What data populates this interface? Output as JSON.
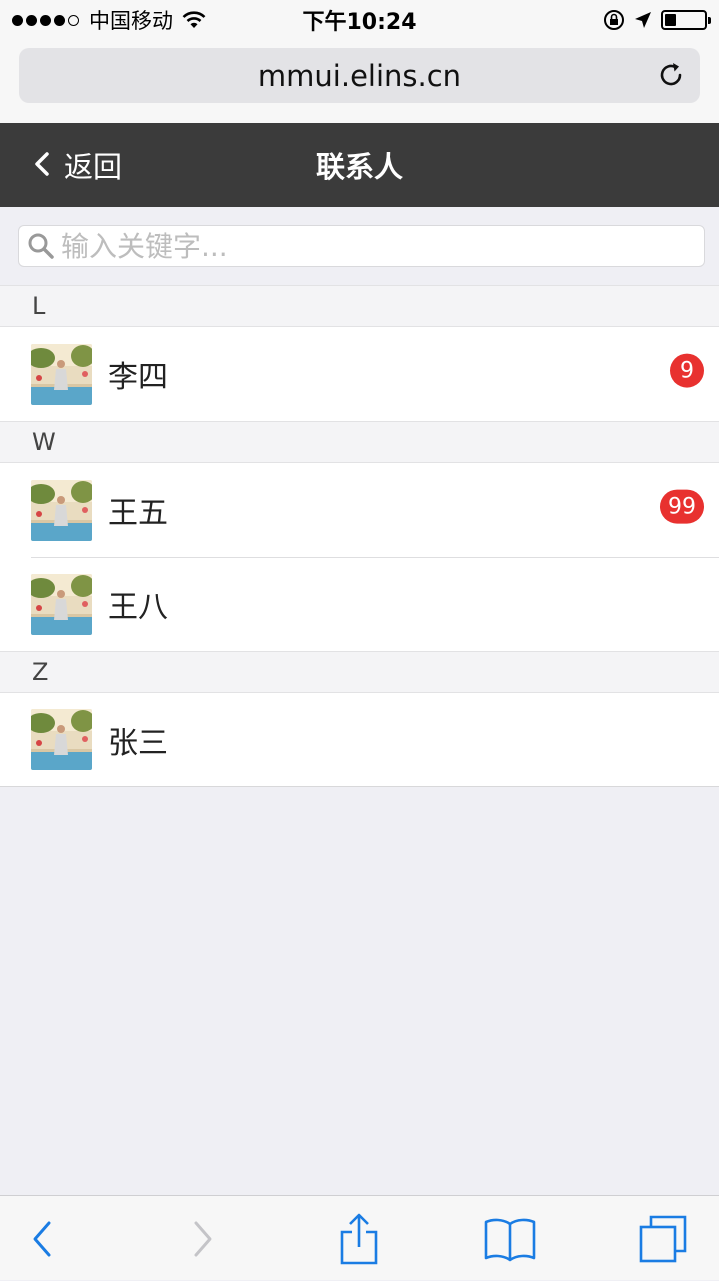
{
  "status_bar": {
    "carrier": "中国移动",
    "time": "下午10:24",
    "battery_level": 0.3
  },
  "browser": {
    "url": "mmui.elins.cn"
  },
  "nav": {
    "back_label": "返回",
    "title": "联系人"
  },
  "search": {
    "placeholder": "输入关键字..."
  },
  "sections": [
    {
      "letter": "L",
      "contacts": [
        {
          "name": "李四",
          "badge": "9"
        }
      ]
    },
    {
      "letter": "W",
      "contacts": [
        {
          "name": "王五",
          "badge": "99"
        },
        {
          "name": "王八",
          "badge": ""
        }
      ]
    },
    {
      "letter": "Z",
      "contacts": [
        {
          "name": "张三",
          "badge": ""
        }
      ]
    }
  ],
  "colors": {
    "nav_bg": "#3b3b3b",
    "badge": "#e8312f",
    "toolbar_accent": "#1a7ce3"
  },
  "icons": {
    "back": "chevron-left-icon",
    "reload": "reload-icon",
    "search": "search-icon",
    "toolbar": [
      "back-arrow-icon",
      "forward-arrow-icon",
      "share-icon",
      "bookmarks-icon",
      "tabs-icon"
    ]
  }
}
